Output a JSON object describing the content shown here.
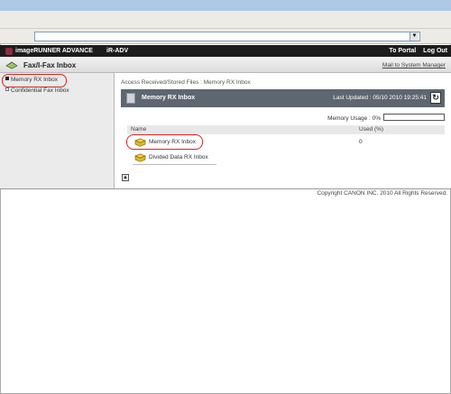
{
  "address_bar": {
    "value": ""
  },
  "app": {
    "brand": "imageRUNNER ADVANCE",
    "model": "iR-ADV",
    "to_portal": "To Portal",
    "log_out": "Log Out"
  },
  "header": {
    "title": "Fax/I-Fax Inbox",
    "mail_link": "Mail to System Manager"
  },
  "sidebar": {
    "items": [
      {
        "label": "Memory RX Inbox",
        "active": true
      },
      {
        "label": "Confidential Fax Inbox",
        "active": false
      }
    ]
  },
  "main": {
    "breadcrumb": "Access Received/Stored Files : Memory RX Inbox",
    "panel_title": "Memory RX Inbox",
    "last_updated": "Last Updated : 05/10 2010 19:25:41",
    "memory_usage": "Memory Usage : 0%",
    "memory_usage_fraction": 0,
    "table": {
      "headers": [
        "Name",
        "Used (%)"
      ],
      "rows": [
        {
          "name": "Memory RX Inbox",
          "used": "0"
        },
        {
          "name": "Divided Data RX Inbox",
          "used": ""
        }
      ]
    }
  },
  "footer": {
    "copyright": "Copyright CANON INC. 2010 All Rights Reserved."
  },
  "colors": {
    "callout": "#dd2222",
    "panel_header": "#5e6670",
    "app_bar": "#1c1c1c"
  },
  "icons": [
    "fax-icon",
    "mailbox-icon",
    "folder-icon",
    "refresh-icon",
    "up-arrow-icon",
    "dropdown-arrow-icon"
  ]
}
